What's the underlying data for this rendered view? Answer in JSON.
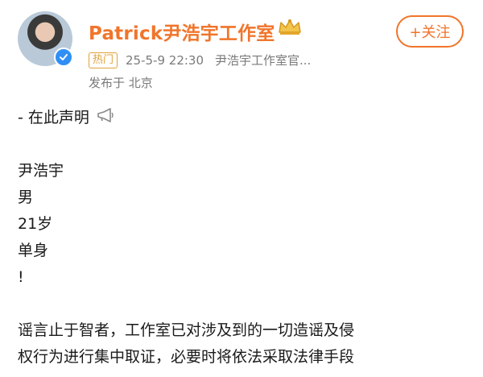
{
  "post": {
    "author_name": "Patrick尹浩宇工作室",
    "follow_label": "+关注",
    "hot_badge": "热门",
    "timestamp": "25-5-9 22:30",
    "source": "尹浩宇工作室官...",
    "location": "发布于 北京",
    "brand_color": "#f0752b",
    "verified_color": "#2f8ff5"
  },
  "content": {
    "line1": "- 在此声明",
    "name": "尹浩宇",
    "gender": "男",
    "age": "21岁",
    "status": "单身",
    "exclaim": "!",
    "para1": "谣言止于智者，工作室已对涉及到的一切造谣及侵",
    "para2": "权行为进行集中取证，必要时将依法采取法律手段"
  },
  "icons": {
    "verified": "verified-check-icon",
    "crown": "crown-icon",
    "megaphone": "megaphone-icon"
  }
}
